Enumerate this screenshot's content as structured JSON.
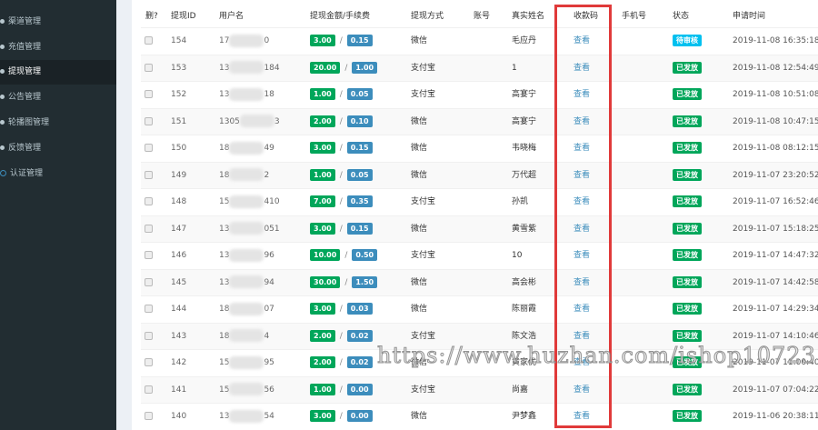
{
  "sidebar": {
    "items": [
      {
        "label": "渠道管理",
        "active": false
      },
      {
        "label": "充值管理",
        "active": false
      },
      {
        "label": "提现管理",
        "active": true
      },
      {
        "label": "公告管理",
        "active": false
      },
      {
        "label": "轮播图管理",
        "active": false
      },
      {
        "label": "反馈管理",
        "active": false
      },
      {
        "label": "认证管理",
        "active": false
      }
    ]
  },
  "table": {
    "headers": {
      "del": "删?",
      "id": "提现ID",
      "user": "用户名",
      "amount": "提现金额/手续费",
      "method": "提现方式",
      "account": "账号",
      "name": "真实姓名",
      "code": "收款码",
      "phone": "手机号",
      "status": "状态",
      "time": "申请时间"
    },
    "rows": [
      {
        "id": "154",
        "user_pre": "17",
        "user_suf": "0",
        "amount": "3.00",
        "fee": "0.15",
        "method": "微信",
        "account": "",
        "name": "毛应丹",
        "code": "查看",
        "phone": "",
        "status": "待审核",
        "time": "2019-11-08 16:35:18"
      },
      {
        "id": "153",
        "user_pre": "13",
        "user_suf": "184",
        "amount": "20.00",
        "fee": "1.00",
        "method": "支付宝",
        "account": "",
        "name": "1",
        "code": "查看",
        "phone": "",
        "status": "已发放",
        "time": "2019-11-08 12:54:49"
      },
      {
        "id": "152",
        "user_pre": "13",
        "user_suf": "18",
        "amount": "1.00",
        "fee": "0.05",
        "method": "支付宝",
        "account": "",
        "name": "高宴宁",
        "code": "查看",
        "phone": "",
        "status": "已发放",
        "time": "2019-11-08 10:51:08"
      },
      {
        "id": "151",
        "user_pre": "1305",
        "user_suf": "3",
        "amount": "2.00",
        "fee": "0.10",
        "method": "微信",
        "account": "",
        "name": "高宴宁",
        "code": "查看",
        "phone": "",
        "status": "已发放",
        "time": "2019-11-08 10:47:15"
      },
      {
        "id": "150",
        "user_pre": "18",
        "user_suf": "49",
        "amount": "3.00",
        "fee": "0.15",
        "method": "微信",
        "account": "",
        "name": "韦晓梅",
        "code": "查看",
        "phone": "",
        "status": "已发放",
        "time": "2019-11-08 08:12:15"
      },
      {
        "id": "149",
        "user_pre": "18",
        "user_suf": "2",
        "amount": "1.00",
        "fee": "0.05",
        "method": "微信",
        "account": "",
        "name": "万代超",
        "code": "查看",
        "phone": "",
        "status": "已发放",
        "time": "2019-11-07 23:20:52"
      },
      {
        "id": "148",
        "user_pre": "15",
        "user_suf": "410",
        "amount": "7.00",
        "fee": "0.35",
        "method": "支付宝",
        "account": "",
        "name": "孙凯",
        "code": "查看",
        "phone": "",
        "status": "已发放",
        "time": "2019-11-07 16:52:46"
      },
      {
        "id": "147",
        "user_pre": "13",
        "user_suf": "051",
        "amount": "3.00",
        "fee": "0.15",
        "method": "微信",
        "account": "",
        "name": "黄雪紫",
        "code": "查看",
        "phone": "",
        "status": "已发放",
        "time": "2019-11-07 15:18:25"
      },
      {
        "id": "146",
        "user_pre": "13",
        "user_suf": "96",
        "amount": "10.00",
        "fee": "0.50",
        "method": "支付宝",
        "account": "",
        "name": "10",
        "code": "查看",
        "phone": "",
        "status": "已发放",
        "time": "2019-11-07 14:47:32"
      },
      {
        "id": "145",
        "user_pre": "13",
        "user_suf": "94",
        "amount": "30.00",
        "fee": "1.50",
        "method": "微信",
        "account": "",
        "name": "高会彬",
        "code": "查看",
        "phone": "",
        "status": "已发放",
        "time": "2019-11-07 14:42:58"
      },
      {
        "id": "144",
        "user_pre": "18",
        "user_suf": "07",
        "amount": "3.00",
        "fee": "0.03",
        "method": "微信",
        "account": "",
        "name": "陈丽霞",
        "code": "查看",
        "phone": "",
        "status": "已发放",
        "time": "2019-11-07 14:29:34"
      },
      {
        "id": "143",
        "user_pre": "18",
        "user_suf": "4",
        "amount": "2.00",
        "fee": "0.02",
        "method": "支付宝",
        "account": "",
        "name": "陈文浩",
        "code": "查看",
        "phone": "",
        "status": "已发放",
        "time": "2019-11-07 14:10:46"
      },
      {
        "id": "142",
        "user_pre": "15",
        "user_suf": "95",
        "amount": "2.00",
        "fee": "0.02",
        "method": "微信",
        "account": "",
        "name": "黄家优",
        "code": "查看",
        "phone": "",
        "status": "已发放",
        "time": "2019-11-07 11:00:40"
      },
      {
        "id": "141",
        "user_pre": "15",
        "user_suf": "56",
        "amount": "1.00",
        "fee": "0.00",
        "method": "支付宝",
        "account": "",
        "name": "尚嘉",
        "code": "查看",
        "phone": "",
        "status": "已发放",
        "time": "2019-11-07 07:04:22"
      },
      {
        "id": "140",
        "user_pre": "13",
        "user_suf": "54",
        "amount": "3.00",
        "fee": "0.00",
        "method": "微信",
        "account": "",
        "name": "尹梦鑫",
        "code": "查看",
        "phone": "",
        "status": "已发放",
        "time": "2019-11-06 20:38:11"
      }
    ]
  },
  "watermark": "https://www.huzhan.com/ishop10723",
  "colors": {
    "success": "#00a65a",
    "primary": "#3c8dbc",
    "info": "#00c0ef",
    "highlight": "#e03a3a"
  }
}
